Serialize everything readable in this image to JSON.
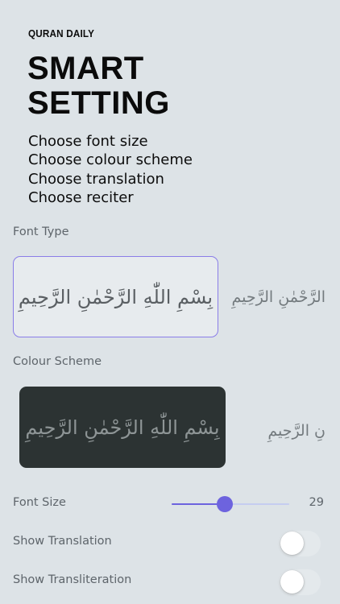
{
  "app": {
    "brand": "QURAN DAILY"
  },
  "headline": {
    "line1": "SMART",
    "line2": "SETTING"
  },
  "features": [
    "Choose font size",
    "Choose colour scheme",
    "Choose translation",
    "Choose reciter"
  ],
  "font_type": {
    "label": "Font Type",
    "selected_sample": "بِسْمِ اللّٰهِ الرَّحْمٰنِ الرَّحِيمِ",
    "next_sample": "الرَّحْمٰنِ الرَّحِيمِ"
  },
  "colour_scheme": {
    "label": "Colour Scheme",
    "selected_sample": "بِسْمِ اللّٰهِ الرَّحْمٰنِ الرَّحِيمِ",
    "next_sample": "نِ الرَّحِيمِ",
    "dark_card_color": "#2c3333"
  },
  "font_size": {
    "label": "Font Size",
    "value": "29",
    "slider_fraction": 0.45
  },
  "show_translation": {
    "label": "Show Translation",
    "on": false
  },
  "show_transliteration": {
    "label": "Show Transliteration",
    "on": false
  },
  "colors": {
    "accent": "#6d63de",
    "background": "#dde3e7",
    "label_gray": "#5e656b"
  }
}
